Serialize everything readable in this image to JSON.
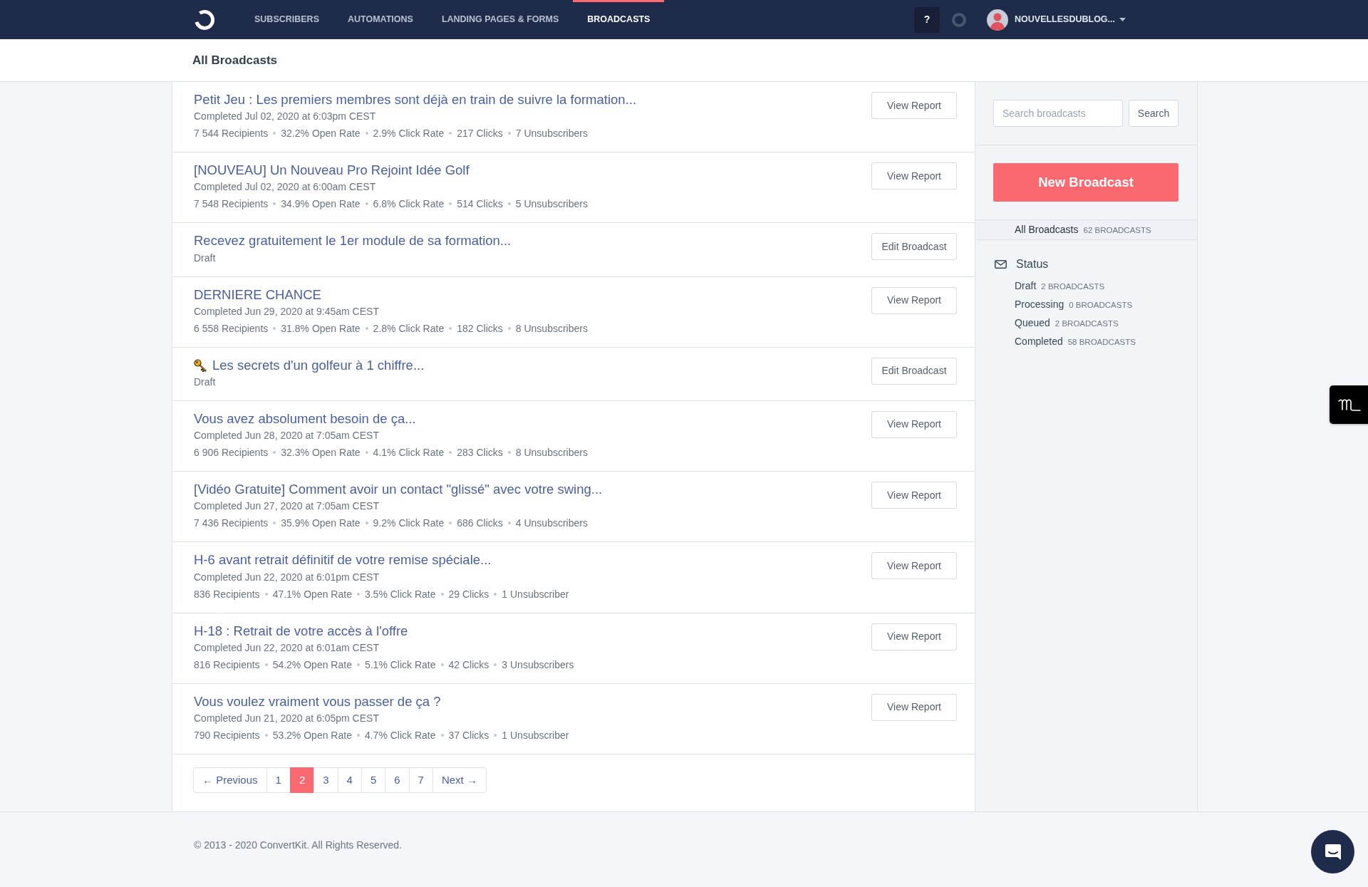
{
  "navbar": {
    "items": [
      {
        "label": "SUBSCRIBERS",
        "selected": false
      },
      {
        "label": "AUTOMATIONS",
        "selected": false
      },
      {
        "label": "LANDING PAGES & FORMS",
        "selected": false
      },
      {
        "label": "BROADCASTS",
        "selected": true
      }
    ],
    "help": "?",
    "user": "NOUVELLESDUBLOG..."
  },
  "page_title": "All Broadcasts",
  "broadcasts": [
    {
      "title": "Petit Jeu : Les premiers membres sont déjà en train de suivre la formation...",
      "emoji_icon": false,
      "status": "Completed Jul 02, 2020 at 6:03pm CEST",
      "stats": [
        "7 544 Recipients",
        "32.2% Open Rate",
        "2.9% Click Rate",
        "217 Clicks",
        "7 Unsubscribers"
      ],
      "button": "View Report"
    },
    {
      "title": "[NOUVEAU] Un Nouveau Pro Rejoint Idée Golf",
      "emoji_icon": false,
      "status": "Completed Jul 02, 2020 at 6:00am CEST",
      "stats": [
        "7 548 Recipients",
        "34.9% Open Rate",
        "6.8% Click Rate",
        "514 Clicks",
        "5 Unsubscribers"
      ],
      "button": "View Report"
    },
    {
      "title": "Recevez gratuitement le 1er module de sa formation...",
      "emoji_icon": false,
      "status": "Draft",
      "button": "Edit Broadcast"
    },
    {
      "title": "DERNIERE CHANCE",
      "emoji_icon": false,
      "status": "Completed Jun 29, 2020 at 9:45am CEST",
      "stats": [
        "6 558 Recipients",
        "31.8% Open Rate",
        "2.8% Click Rate",
        "182 Clicks",
        "8 Unsubscribers"
      ],
      "button": "View Report"
    },
    {
      "title": "Les secrets d'un golfeur à 1 chiffre...",
      "emoji_icon": true,
      "status": "Draft",
      "button": "Edit Broadcast"
    },
    {
      "title": "Vous avez absolument besoin de ça...",
      "emoji_icon": false,
      "status": "Completed Jun 28, 2020 at 7:05am CEST",
      "stats": [
        "6 906 Recipients",
        "32.3% Open Rate",
        "4.1% Click Rate",
        "283 Clicks",
        "8 Unsubscribers"
      ],
      "button": "View Report"
    },
    {
      "title": "[Vidéo Gratuite] Comment avoir un contact \"glissé\" avec votre swing...",
      "emoji_icon": false,
      "status": "Completed Jun 27, 2020 at 7:05am CEST",
      "stats": [
        "7 436 Recipients",
        "35.9% Open Rate",
        "9.2% Click Rate",
        "686 Clicks",
        "4 Unsubscribers"
      ],
      "button": "View Report"
    },
    {
      "title": "H-6 avant retrait définitif de votre remise spéciale...",
      "emoji_icon": false,
      "status": "Completed Jun 22, 2020 at 6:01pm CEST",
      "stats": [
        "836 Recipients",
        "47.1% Open Rate",
        "3.5% Click Rate",
        "29 Clicks",
        "1 Unsubscriber"
      ],
      "button": "View Report"
    },
    {
      "title": "H-18 : Retrait de votre accès à l'offre",
      "emoji_icon": false,
      "status": "Completed Jun 22, 2020 at 6:01am CEST",
      "stats": [
        "816 Recipients",
        "54.2% Open Rate",
        "5.1% Click Rate",
        "42 Clicks",
        "3 Unsubscribers"
      ],
      "button": "View Report"
    },
    {
      "title": "Vous voulez vraiment vous passer de ça ?",
      "emoji_icon": false,
      "status": "Completed Jun 21, 2020 at 6:05pm CEST",
      "stats": [
        "790 Recipients",
        "53.2% Open Rate",
        "4.7% Click Rate",
        "37 Clicks",
        "1 Unsubscriber"
      ],
      "button": "View Report"
    }
  ],
  "pagination": {
    "previous": "← Previous",
    "pages": [
      {
        "label": "1",
        "selected": false
      },
      {
        "label": "2",
        "selected": true
      },
      {
        "label": "3",
        "selected": false
      },
      {
        "label": "4",
        "selected": false
      },
      {
        "label": "5",
        "selected": false
      },
      {
        "label": "6",
        "selected": false
      },
      {
        "label": "7",
        "selected": false
      }
    ],
    "next": "Next →"
  },
  "sidebar": {
    "search": {
      "placeholder": "Search broadcasts",
      "button": "Search"
    },
    "new_button": "New Broadcast",
    "all": {
      "label": "All Broadcasts",
      "count": "62 BROADCASTS",
      "selected": true
    },
    "status_title": "Status",
    "statuses": [
      {
        "label": "Draft",
        "count": "2 BROADCASTS",
        "selected": false
      },
      {
        "label": "Processing",
        "count": "0 BROADCASTS",
        "selected": false
      },
      {
        "label": "Queued",
        "count": "2 BROADCASTS",
        "selected": false
      },
      {
        "label": "Completed",
        "count": "58 BROADCASTS",
        "selected": false
      }
    ]
  },
  "footer": "© 2013 - 2020 ConvertKit. All Rights Reserved."
}
